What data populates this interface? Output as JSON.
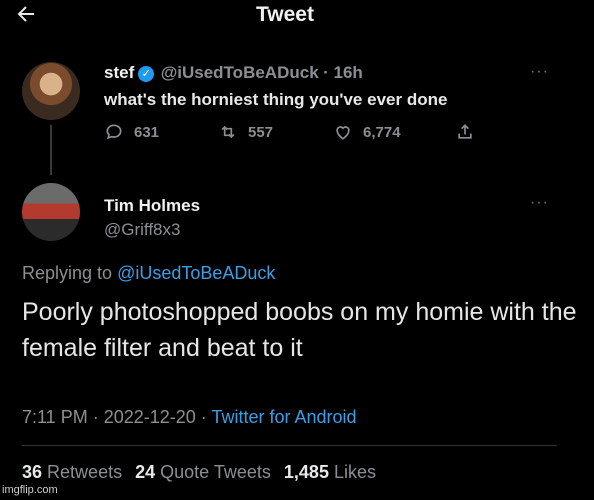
{
  "header": {
    "back_icon": "arrow-left-icon",
    "title": "Tweet"
  },
  "tweet1": {
    "name": "stef",
    "handle": "@iUsedToBeADuck",
    "time": "· 16h",
    "text": "what's the horniest thing you've ever done",
    "more": "···",
    "replies": "631",
    "retweets": "557",
    "likes": "6,774",
    "accent_color": "#1d9bf0"
  },
  "tweet2": {
    "name": "Tim Holmes",
    "handle": "@Griff8x3",
    "more": "···",
    "replying_prefix": "Replying to ",
    "replying_handle": "@iUsedToBeADuck",
    "text": "Poorly photoshopped boobs on my homie with the female filter and beat to it",
    "time": "7:11 PM · 2022-12-20 · ",
    "source": "Twitter for Android",
    "retweets_count": "36",
    "retweets_label": "Retweets",
    "quotes_count": "24",
    "quotes_label": "Quote Tweets",
    "likes_count": "1,485",
    "likes_label": "Likes",
    "link_color": "#3b9fe6"
  },
  "watermark": "imgflip.com"
}
